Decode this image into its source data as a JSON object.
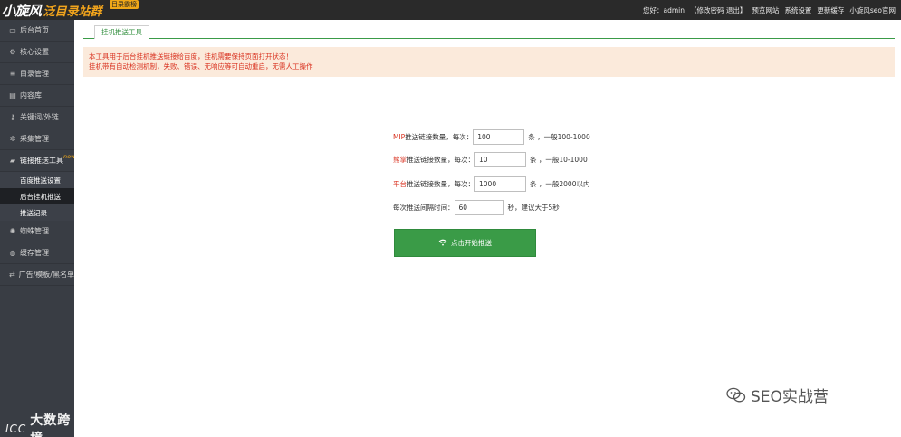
{
  "header": {
    "logo_main": "小旋风",
    "logo_sub": "泛目录站群",
    "logo_badge": "目录霸榜",
    "greeting": "您好：admin",
    "account_links": "【修改密码 退出】",
    "nav": [
      "预览网站",
      "系统设置",
      "更新缓存",
      "小旋风seo官网"
    ]
  },
  "sidebar": {
    "items": [
      {
        "label": "后台首页",
        "icon": "monitor-icon"
      },
      {
        "label": "核心设置",
        "icon": "gear-icon"
      },
      {
        "label": "目录管理",
        "icon": "list-icon"
      },
      {
        "label": "内容库",
        "icon": "book-icon"
      },
      {
        "label": "关键词/外链",
        "icon": "key-icon"
      },
      {
        "label": "采集管理",
        "icon": "gear-icon"
      },
      {
        "label": "链接推送工具",
        "icon": "push-icon",
        "badge": "new"
      }
    ],
    "sub_items": [
      {
        "label": "百度推送设置"
      },
      {
        "label": "后台挂机推送"
      },
      {
        "label": "推送记录"
      }
    ],
    "items_after": [
      {
        "label": "蜘蛛管理",
        "icon": "spider-icon"
      },
      {
        "label": "缓存管理",
        "icon": "database-icon"
      },
      {
        "label": "广告/模板/黑名单",
        "icon": "shuffle-icon"
      }
    ],
    "watermark": "大数跨境",
    "watermark_mark": "ⅠⅭⅭ"
  },
  "main": {
    "tab_label": "挂机推送工具",
    "notice_line1": "本工具用于后台挂机推送链接给百度，挂机需要保持页面打开状态！",
    "notice_line2": "挂机带有自动检测机制，失败、错误、无响应等可自动重启，无需人工操作"
  },
  "form": {
    "mip": {
      "prefix": "MIP",
      "label": "推送链接数量，每次：",
      "value": "100",
      "hint": "条 ，一般100-1000"
    },
    "fast": {
      "prefix": "熊掌",
      "label": "推送链接数量，每次：",
      "value": "10",
      "hint": "条 ，一般10-1000"
    },
    "platform": {
      "prefix": "平台",
      "label": "推送链接数量，每次：",
      "value": "1000",
      "hint": "条 ，一般2000以内"
    },
    "interval": {
      "label": "每次推送间隔时间：",
      "value": "60",
      "hint": "秒，建议大于5秒"
    },
    "start_button": "点击开始推送"
  },
  "watermark": {
    "text": "SEO实战营"
  }
}
